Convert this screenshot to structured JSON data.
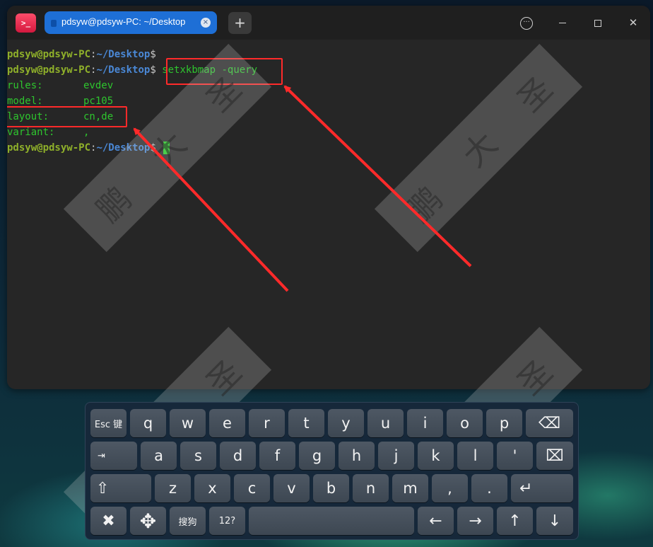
{
  "window": {
    "app_icon": ">_",
    "tab_title": "pdsyw@pdsyw-PC: ~/Desktop",
    "tab_close": "×",
    "new_tab": "+",
    "more": "···",
    "close": "✕"
  },
  "terminal": {
    "user_host": "pdsyw@pdsyw-PC",
    "colon": ":",
    "path": "~/Desktop",
    "dollar": "$",
    "command": " setxkbmap -query",
    "outputs": [
      {
        "key": "rules:",
        "value": "evdev"
      },
      {
        "key": "model:",
        "value": "pc105"
      },
      {
        "key": "layout:",
        "value": "cn,de"
      },
      {
        "key": "variant:",
        "value": ","
      }
    ]
  },
  "watermark": {
    "chars": [
      "鹏",
      "大",
      "圣"
    ]
  },
  "keyboard": {
    "row1": [
      "Esc 键",
      "q",
      "w",
      "e",
      "r",
      "t",
      "y",
      "u",
      "i",
      "o",
      "p",
      "⌫"
    ],
    "row2": [
      "⇥",
      "a",
      "s",
      "d",
      "f",
      "g",
      "h",
      "j",
      "k",
      "l",
      "'",
      "⌧"
    ],
    "row3": [
      "⇧",
      "z",
      "x",
      "c",
      "v",
      "b",
      "n",
      "m",
      ",",
      ".",
      "↵"
    ],
    "row4": [
      "✖",
      "✥",
      "搜狗",
      "12?",
      "",
      "←",
      "→",
      "↑",
      "↓"
    ]
  },
  "colors": {
    "annotation": "#ff2a2a",
    "prompt_user": "#8fb02a",
    "prompt_path": "#4a88d6",
    "output_text": "#2ec52e",
    "tab_active": "#1e6fd6"
  }
}
